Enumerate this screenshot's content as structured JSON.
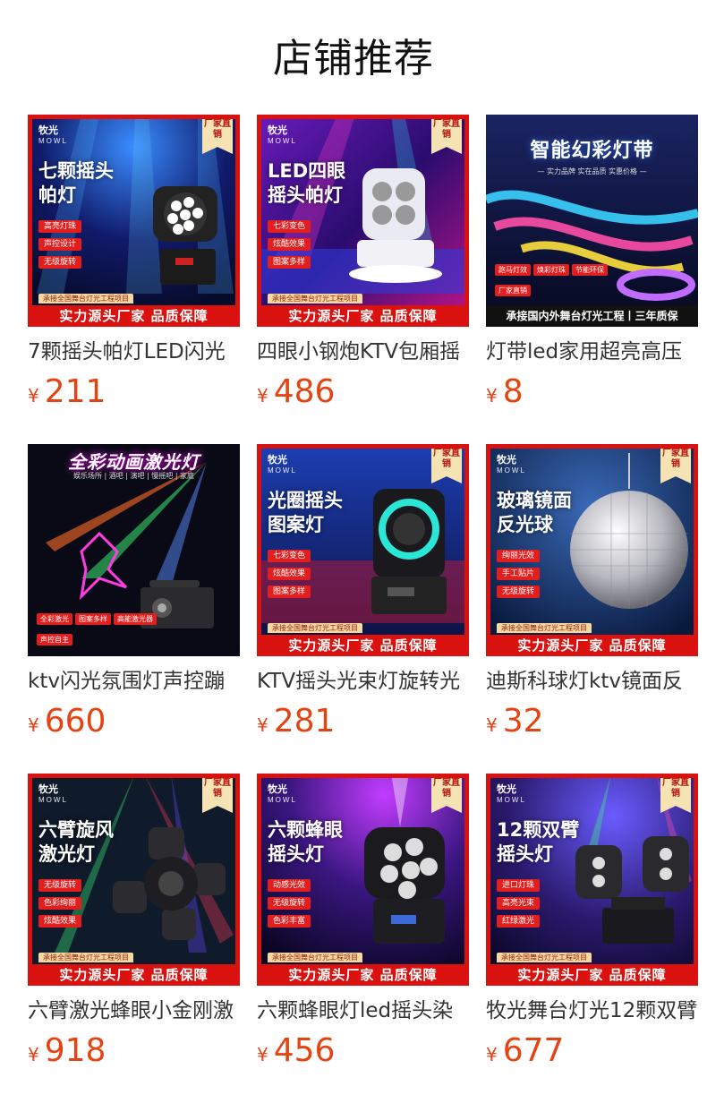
{
  "header": {
    "title": "店铺推荐"
  },
  "colors": {
    "price": "#e44312",
    "banner_red": "#d9120f",
    "tag_gold": "#f6e3b4"
  },
  "shared": {
    "brand_cn": "牧光",
    "brand_en": "MOWL",
    "corner_tag": "厂家直销",
    "sub_banner": "承接全国舞台灯光工程项目",
    "banner": "实力源头厂家 品质保障"
  },
  "products": [
    {
      "title": "7颗摇头帕灯LED闪光",
      "currency": "¥",
      "price": "211",
      "image": {
        "headline": "七颗摇头\n帕灯",
        "features": [
          "高亮灯珠",
          "声控设计",
          "无级旋转"
        ],
        "icon": "moving-head-par-light"
      }
    },
    {
      "title": "四眼小钢炮KTV包厢摇",
      "currency": "¥",
      "price": "486",
      "image": {
        "headline": "LED四眼\n摇头帕灯",
        "features": [
          "七彩变色",
          "炫酷效果",
          "图案多样"
        ],
        "icon": "four-eye-moving-head"
      }
    },
    {
      "title": "灯带led家用超亮高压",
      "currency": "¥",
      "price": "8",
      "image": {
        "headline": "智能幻彩灯带",
        "tagline": "— 实力品牌 实在品质 实惠价格 —",
        "tags": [
          "跑马灯效",
          "焕彩灯珠",
          "节能环保",
          "厂家直销"
        ],
        "banner": "承接国内外舞台灯光工程丨三年质保",
        "icon": "led-strip"
      }
    },
    {
      "title": "ktv闪光氛围灯声控蹦",
      "currency": "¥",
      "price": "660",
      "image": {
        "headline": "全彩动画激光灯",
        "tagline": "娱乐场所 | 酒吧 | 演吧 | 慢摇吧 | 家庭",
        "tags": [
          "全彩激光",
          "图案多样",
          "高能激光器",
          "声控自主"
        ],
        "icon": "laser-projector"
      }
    },
    {
      "title": "KTV摇头光束灯旋转光",
      "currency": "¥",
      "price": "281",
      "image": {
        "headline": "光圈摇头\n图案灯",
        "features": [
          "七彩变色",
          "炫酷效果",
          "图案多样"
        ],
        "icon": "ring-moving-head"
      }
    },
    {
      "title": "迪斯科球灯ktv镜面反",
      "currency": "¥",
      "price": "32",
      "image": {
        "headline": "玻璃镜面\n反光球",
        "features": [
          "绚丽光效",
          "手工贴片",
          "无级旋转"
        ],
        "icon": "mirror-ball"
      }
    },
    {
      "title": "六臂激光蜂眼小金刚激",
      "currency": "¥",
      "price": "918",
      "image": {
        "headline": "六臂旋风\n激光灯",
        "features": [
          "无级旋转",
          "色彩绚丽",
          "炫酷效果"
        ],
        "icon": "six-arm-laser"
      }
    },
    {
      "title": "六颗蜂眼灯led摇头染",
      "currency": "¥",
      "price": "456",
      "image": {
        "headline": "六颗蜂眼\n摇头灯",
        "features": [
          "动感光效",
          "无级旋转",
          "色彩丰富"
        ],
        "icon": "bee-eye-moving-head"
      }
    },
    {
      "title": "牧光舞台灯光12颗双臂",
      "currency": "¥",
      "price": "677",
      "image": {
        "headline": "12颗双臂\n摇头灯",
        "features": [
          "进口灯珠",
          "高亮光束",
          "红绿激光"
        ],
        "icon": "double-arm-moving-head"
      }
    }
  ]
}
